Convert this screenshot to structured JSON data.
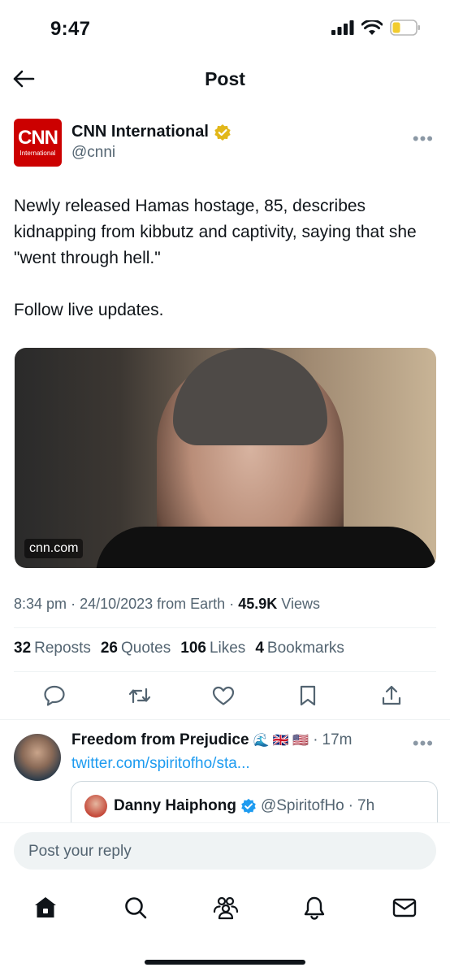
{
  "status_bar": {
    "time": "9:47"
  },
  "header": {
    "title": "Post"
  },
  "author": {
    "name": "CNN International",
    "handle": "@cnni",
    "logo_text": "CNN",
    "logo_sub": "International"
  },
  "tweet": {
    "text_1": "Newly released Hamas hostage, 85, describes kidnapping from kibbutz and captivity, saying that she \"went through hell.\"",
    "text_2": "Follow live updates.",
    "media_caption": "cnn.com",
    "time": "8:34 pm",
    "date": "24/10/2023",
    "source": "from Earth",
    "views_count": "45.9K",
    "views_label": "Views"
  },
  "stats": {
    "reposts_count": "32",
    "reposts_label": "Reposts",
    "quotes_count": "26",
    "quotes_label": "Quotes",
    "likes_count": "106",
    "likes_label": "Likes",
    "bookmarks_count": "4",
    "bookmarks_label": "Bookmarks"
  },
  "reply": {
    "name": "Freedom from Prejudice",
    "emojis": "🌊 🇬🇧 🇺🇸",
    "time": "17m",
    "link": "twitter.com/spiritofho/sta...",
    "quote": {
      "name": "Danny Haiphong",
      "handle": "@SpiritofHo",
      "time": "7h"
    }
  },
  "composer": {
    "placeholder": "Post your reply"
  },
  "icons": [
    "back-arrow-icon",
    "verified-badge-icon",
    "more-icon",
    "reply-icon",
    "repost-icon",
    "like-icon",
    "bookmark-icon",
    "share-icon",
    "home-icon",
    "search-icon",
    "communities-icon",
    "notifications-icon",
    "messages-icon"
  ],
  "colors": {
    "accent": "#1d9bf0",
    "verified_gold": "#e2b719",
    "cnn_red": "#cc0000",
    "text": "#0f1419",
    "muted": "#536471"
  }
}
